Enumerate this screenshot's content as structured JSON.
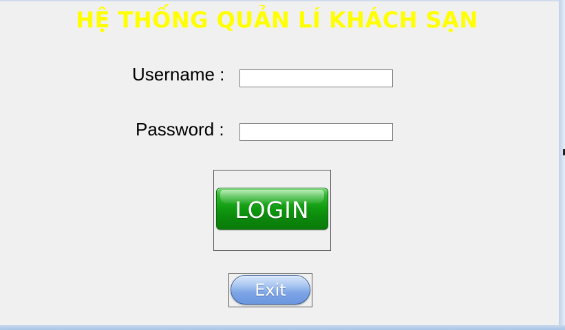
{
  "window": {
    "title": "HỆ THỐNG QUẢN LÍ KHÁCH SẠN"
  },
  "form": {
    "username_label": "Username :",
    "username_value": "",
    "password_label": "Password :",
    "password_value": "",
    "login_label": "LOGIN",
    "exit_label": "Exit"
  },
  "colors": {
    "title": "#ffff00",
    "panel_background": "#f0f0f0",
    "login_button": "#109a10",
    "exit_button": "#7da5e5"
  }
}
